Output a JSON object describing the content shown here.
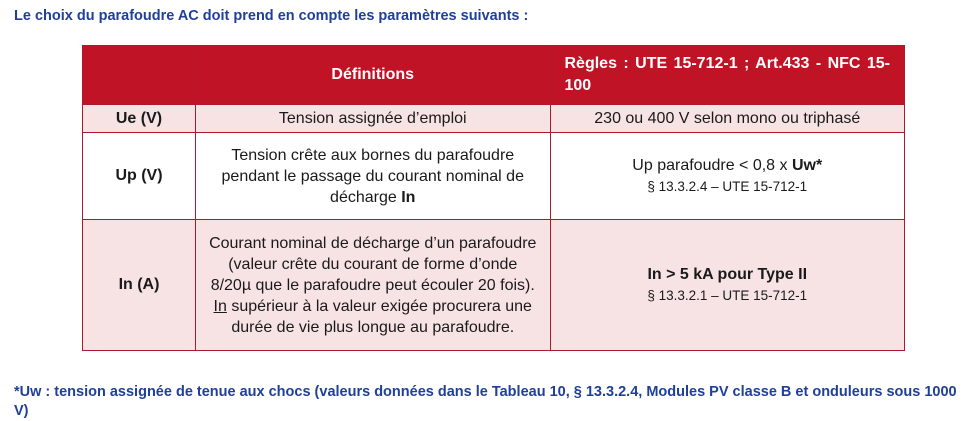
{
  "heading": "Le choix du parafoudre AC doit prend en compte les paramètres suivants :",
  "table": {
    "header": {
      "definitions": "Définitions",
      "rules": "Règles : UTE 15-712-1 ; Art.433 - NFC 15-100"
    },
    "rows": [
      {
        "symbol": "Ue (V)",
        "definition": "Tension assignée d’emploi",
        "rule": "230 ou 400 V selon mono ou triphasé"
      },
      {
        "symbol": "Up (V)",
        "definition_l1": "Tension crête aux bornes du parafoudre",
        "definition_l2": "pendant le passage du courant nominal de",
        "definition_l3_a": "décharge ",
        "definition_l3_b": "In",
        "rule_a": "Up parafoudre < 0,8 x ",
        "rule_b": "Uw*",
        "rule_ref": "§ 13.3.2.4 – UTE 15-712-1"
      },
      {
        "symbol": "In (A)",
        "definition_l1": "Courant nominal de décharge d’un parafoudre",
        "definition_l2": "(valeur crête du courant de forme d’onde",
        "definition_l3": "8/20µ que le parafoudre peut écouler 20 fois).",
        "definition_l4_a": "In",
        "definition_l4_b": " supérieur à la valeur exigée procurera une",
        "definition_l5": "durée de vie plus longue au parafoudre.",
        "rule": "In > 5 kA pour Type II",
        "rule_ref": "§ 13.3.2.1 – UTE 15-712-1"
      }
    ]
  },
  "footnote": "*Uw : tension assignée de tenue aux chocs (valeurs données dans le Tableau 10, § 13.3.2.4, Modules PV classe B et onduleurs sous 1000 V)",
  "colors": {
    "header_bg": "#c01326",
    "row_tint": "#f7e3e4",
    "title_blue": "#1f3f99"
  }
}
